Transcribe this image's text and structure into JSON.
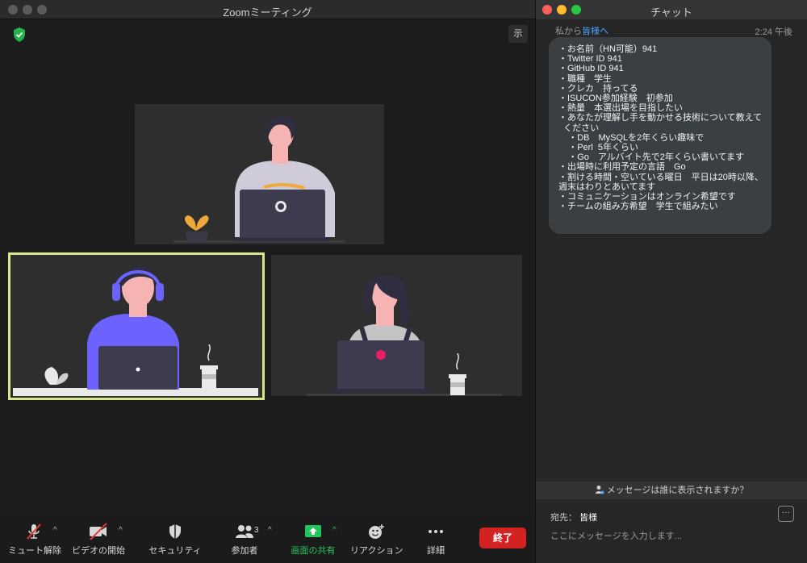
{
  "meeting": {
    "title": "Zoomミーティング",
    "view_button": "示"
  },
  "toolbar": {
    "unmute": "ミュート解除",
    "start_video": "ビデオの開始",
    "security": "セキュリティ",
    "participants": "参加者",
    "participant_count": "3",
    "share_screen": "画面の共有",
    "reactions": "リアクション",
    "more": "詳細",
    "end": "終了"
  },
  "chat": {
    "title": "チャット",
    "from_label": "私から",
    "to_label": "皆様へ",
    "time": "2:24 午後",
    "message_lines": [
      "・お名前（HN可能）941",
      "・Twitter ID 941",
      "・GitHub ID 941",
      "・職種　学生",
      "・クレカ　持ってる",
      "・ISUCON参加経験　初参加",
      "・熱量　本選出場を目指したい",
      "・あなたが理解し手を動かせる技術について教えて",
      "  ください",
      "    ・DB　MySQLを2年くらい趣味で",
      "    ・Perl  5年くらい",
      "    ・Go　アルバイト先で2年くらい書いてます",
      "・出場時に利用予定の言語　Go",
      "・割ける時間・空いている曜日　平日は20時以降、",
      "週末はわりとあいてます",
      "・コミュニケーションはオンライン希望です",
      "・チームの組み方希望　学生で組みたい"
    ],
    "visibility_notice": "メッセージは誰に表示されますか？",
    "send_to_label": "宛先：",
    "send_to_value": "皆様",
    "more_button": "···",
    "input_placeholder": "ここにメッセージを入力します..."
  },
  "colors": {
    "active_speaker": "#d7e58b",
    "share_green": "#22c55e",
    "end_red": "#d32222",
    "chat_link": "#4ea3ff"
  }
}
